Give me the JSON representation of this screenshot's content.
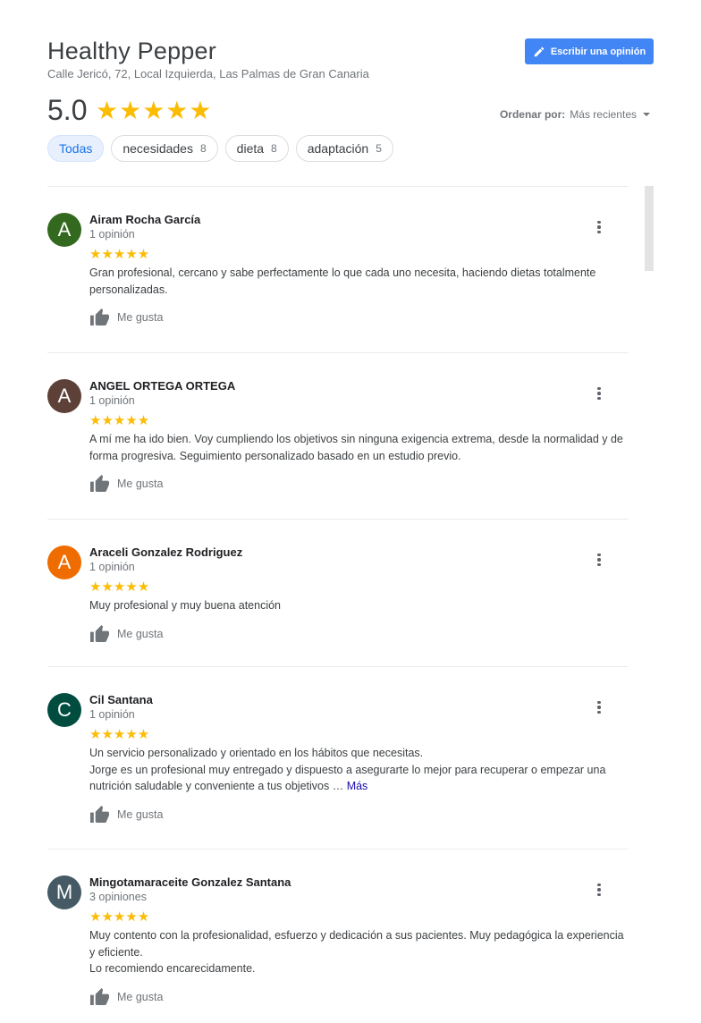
{
  "header": {
    "title": "Healthy Pepper",
    "address": "Calle Jericó, 72, Local Izquierda, Las Palmas de Gran Canaria",
    "write_review_label": "Escribir una opinión",
    "rating": "5.0",
    "rating_stars": "★★★★★",
    "sort_label": "Ordenar por:",
    "sort_value": "Más recientes"
  },
  "chips": [
    {
      "label": "Todas",
      "count": ""
    },
    {
      "label": "necesidades",
      "count": "8"
    },
    {
      "label": "dieta",
      "count": "8"
    },
    {
      "label": "adaptación",
      "count": "5"
    }
  ],
  "reviews": [
    {
      "initial": "A",
      "avatar_color": "#33691e",
      "name": "Airam Rocha García",
      "count": "1 opinión",
      "stars": "★★★★★",
      "text": "Gran profesional, cercano y sabe perfectamente  lo que cada uno necesita, haciendo dietas totalmente personalizadas.",
      "like_label": "Me gusta"
    },
    {
      "initial": "A",
      "avatar_color": "#5d4037",
      "name": "ANGEL ORTEGA ORTEGA",
      "count": "1 opinión",
      "stars": "★★★★★",
      "text": "A mí me ha ido bien. Voy cumpliendo los objetivos sin ninguna exigencia extrema, desde la normalidad y de forma progresiva. Seguimiento personalizado basado en un estudio previo.",
      "like_label": "Me gusta"
    },
    {
      "initial": "A",
      "avatar_color": "#ef6c00",
      "name": "Araceli Gonzalez Rodriguez",
      "count": "1 opinión",
      "stars": "★★★★★",
      "text": "Muy profesional y muy buena atención",
      "like_label": "Me gusta"
    },
    {
      "initial": "C",
      "avatar_color": "#004d40",
      "name": "Cil Santana",
      "count": "1 opinión",
      "stars": "★★★★★",
      "text_line1": "Un servicio personalizado y orientado en los hábitos que necesitas.",
      "text_line2": "Jorge es un profesional muy entregado y dispuesto a asegurarte lo mejor para recuperar o empezar una nutrición saludable y conveniente a tus objetivos …",
      "more_label": "Más",
      "like_label": "Me gusta"
    },
    {
      "initial": "M",
      "avatar_color": "#455a64",
      "name": "Mingotamaraceite Gonzalez Santana",
      "count": "3 opiniones",
      "stars": "★★★★★",
      "text_line1": "Muy contento con la profesionalidad, esfuerzo y dedicación a sus pacientes. Muy pedagógica la experiencia y eficiente.",
      "text_line2": "Lo recomiendo encarecidamente.",
      "like_label": "Me gusta"
    }
  ]
}
